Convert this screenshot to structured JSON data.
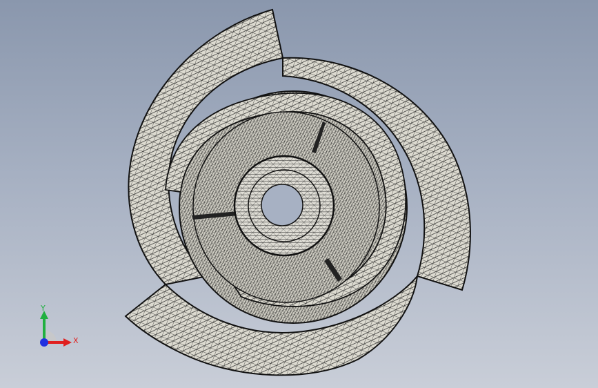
{
  "triad": {
    "x_label": "X",
    "y_label": "Y",
    "x_color": "#e02020",
    "y_color": "#20b040",
    "z_color": "#2030e0"
  },
  "colors": {
    "background_top": "#8a97ad",
    "background_bottom": "#c9ced8",
    "mesh_face": "#d8d6cc",
    "mesh_line": "#2a2a2a"
  }
}
